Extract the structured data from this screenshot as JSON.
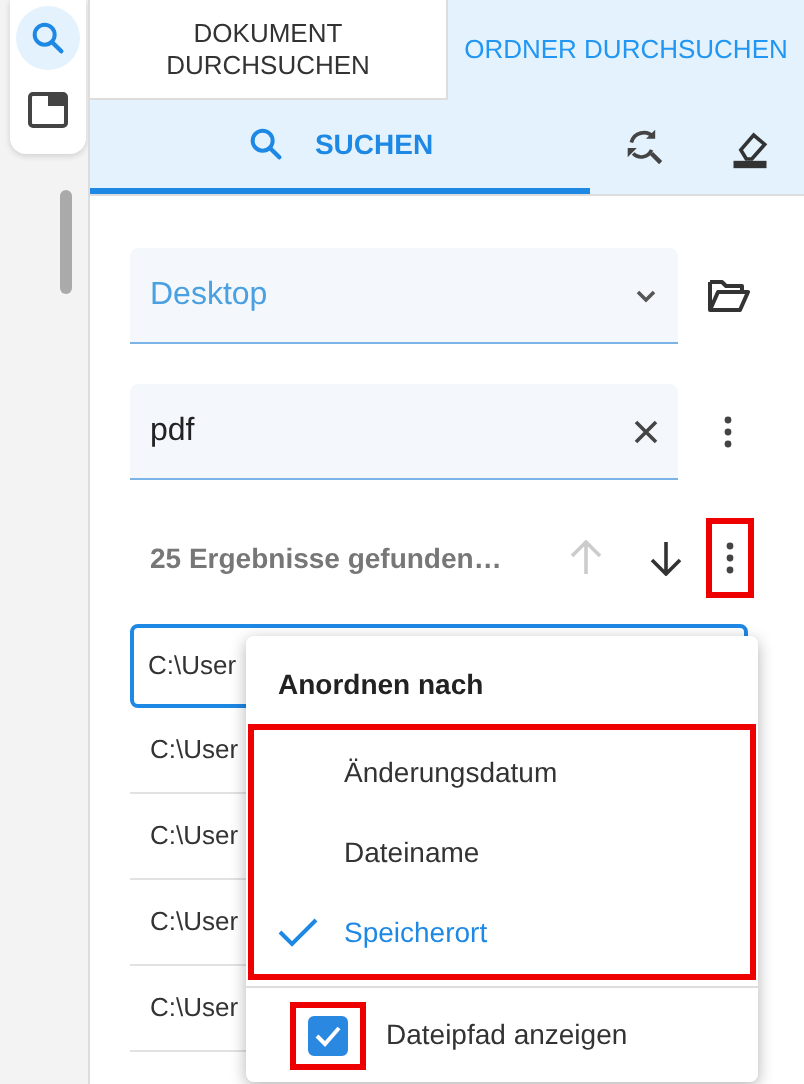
{
  "rail": {
    "items": [
      {
        "selected": true
      },
      {
        "selected": false
      }
    ]
  },
  "tabs": [
    {
      "label": "DOKUMENT DURCHSUCHEN",
      "selected": false
    },
    {
      "label": "ORDNER DURCHSUCHEN",
      "selected": true
    }
  ],
  "toolbar": {
    "search_tab": {
      "label": "SUCHEN",
      "selected": true
    }
  },
  "location": {
    "value": "Desktop"
  },
  "query": {
    "value": "pdf"
  },
  "results": {
    "summary": "25 Ergebnisse gefunden…",
    "previous_disabled": true,
    "more_highlighted": true
  },
  "result_rows": [
    {
      "path": "C:\\User",
      "selected": true
    },
    {
      "path": "C:\\User",
      "selected": false
    },
    {
      "path": "C:\\User",
      "selected": false
    },
    {
      "path": "C:\\User",
      "selected": false
    },
    {
      "path": "C:\\User",
      "selected": false
    }
  ],
  "menu": {
    "title": "Anordnen nach",
    "options_highlighted": true,
    "options": [
      {
        "label": "Änderungsdatum",
        "selected": false
      },
      {
        "label": "Dateiname",
        "selected": false
      },
      {
        "label": "Speicherort",
        "selected": true
      }
    ],
    "show_path": {
      "label": "Dateipfad anzeigen",
      "checked": true,
      "highlighted": true
    }
  }
}
